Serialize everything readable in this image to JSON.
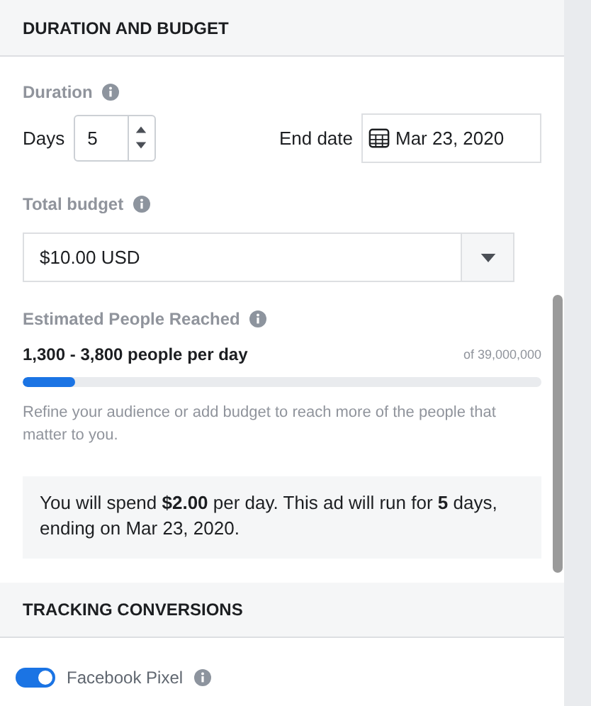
{
  "sections": [
    {
      "title": "DURATION AND BUDGET"
    },
    {
      "title": "TRACKING CONVERSIONS"
    }
  ],
  "duration": {
    "label": "Duration",
    "days_label": "Days",
    "days_value": "5",
    "end_date_label": "End date",
    "end_date_value": "Mar 23, 2020"
  },
  "budget": {
    "label": "Total budget",
    "value": "$10.00 USD"
  },
  "reach": {
    "label": "Estimated People Reached",
    "range": "1,300 - 3,800 people per day",
    "total": "of 39,000,000",
    "level": 0.1,
    "hint": "Refine your audience or add budget to reach more of the people that matter to you."
  },
  "summary": "You will spend **$2.00** per day. This ad will run for **5** days, ending on Mar 23, 2020.",
  "pixel": {
    "label": "Facebook Pixel",
    "on": true
  }
}
